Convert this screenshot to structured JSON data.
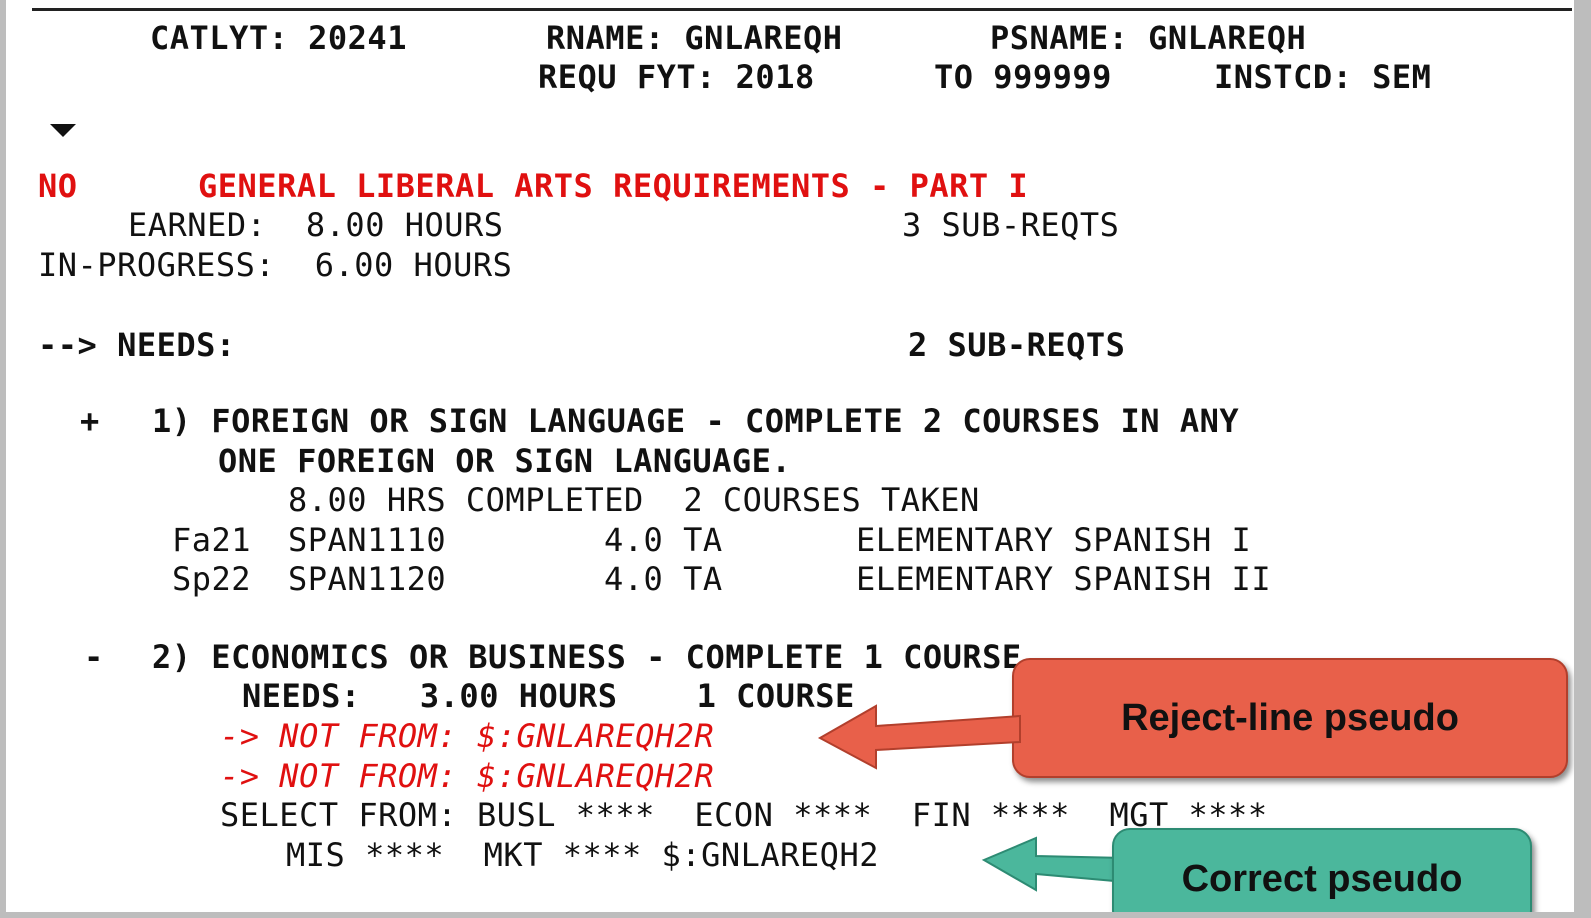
{
  "header": {
    "catlyt": "CATLYT: 20241",
    "rname": "RNAME: GNLAREQH",
    "psname": "PSNAME: GNLAREQH",
    "requ_fyt": "REQU FYT: 2018",
    "to": "TO 999999",
    "instcd": "INSTCD: SEM"
  },
  "requirement": {
    "status": "NO",
    "title": "GENERAL LIBERAL ARTS REQUIREMENTS - PART I",
    "earned": "EARNED:  8.00 HOURS",
    "subreqts": "3 SUB-REQTS",
    "in_progress": "IN-PROGRESS:  6.00 HOURS",
    "needs": "--> NEEDS:",
    "needs_subreqts": "2 SUB-REQTS"
  },
  "sub1": {
    "marker": "+",
    "title_line1": "1) FOREIGN OR SIGN LANGUAGE - COMPLETE 2 COURSES IN ANY",
    "title_line2": "ONE FOREIGN OR SIGN LANGUAGE.",
    "summary": "8.00 HRS COMPLETED  2 COURSES TAKEN",
    "courses": [
      {
        "term": "Fa21",
        "course": "SPAN1110",
        "credits": "4.0 TA",
        "title": "ELEMENTARY SPANISH I"
      },
      {
        "term": "Sp22",
        "course": "SPAN1120",
        "credits": "4.0 TA",
        "title": "ELEMENTARY SPANISH II"
      }
    ]
  },
  "sub2": {
    "marker": "-",
    "title": "2) ECONOMICS OR BUSINESS - COMPLETE 1 COURSE",
    "needs": "NEEDS:   3.00 HOURS    1 COURSE",
    "reject1": "-> NOT FROM: $:GNLAREQH2R",
    "reject2": "-> NOT FROM: $:GNLAREQH2R",
    "select1": "SELECT FROM: BUSL ****  ECON ****  FIN ****  MGT ****",
    "select2": "MIS ****  MKT **** $:GNLAREQH2"
  },
  "callouts": {
    "reject": "Reject-line pseudo",
    "correct": "Correct pseudo",
    "reject_color": "#e8604a",
    "correct_color": "#4bb79c"
  }
}
